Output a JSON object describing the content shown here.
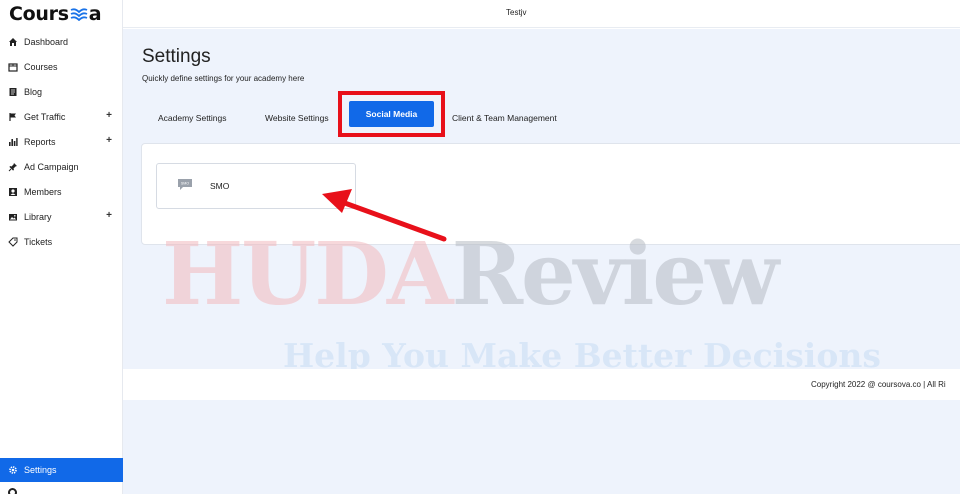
{
  "brand": {
    "name_prefix": "Cours",
    "name_suffix": "a",
    "book_icon": "open-book-icon"
  },
  "topbar": {
    "user": "Testjv"
  },
  "sidebar": {
    "items": [
      {
        "label": "Dashboard",
        "icon": "home-icon",
        "expandable": false
      },
      {
        "label": "Courses",
        "icon": "box-icon",
        "expandable": false
      },
      {
        "label": "Blog",
        "icon": "blog-icon",
        "expandable": false
      },
      {
        "label": "Get Traffic",
        "icon": "flag-icon",
        "expandable": true
      },
      {
        "label": "Reports",
        "icon": "bar-chart-icon",
        "expandable": true
      },
      {
        "label": "Ad Campaign",
        "icon": "pin-icon",
        "expandable": false
      },
      {
        "label": "Members",
        "icon": "person-icon",
        "expandable": false
      },
      {
        "label": "Library",
        "icon": "image-icon",
        "expandable": true
      },
      {
        "label": "Tickets",
        "icon": "ticket-icon",
        "expandable": false
      }
    ],
    "expand_symbol": "+",
    "active": {
      "label": "Settings",
      "icon": "gear-icon"
    }
  },
  "page": {
    "title": "Settings",
    "subtitle": "Quickly define settings for your academy here"
  },
  "tabs": {
    "items": [
      "Academy Settings",
      "Website Settings",
      "Social Media",
      "Client & Team Management"
    ],
    "active_index": 2
  },
  "card": {
    "smo_label": "SMO",
    "smo_icon_text": "SMO"
  },
  "watermark": {
    "main_a": "HUDA",
    "main_b": "Review",
    "sub": "Help You Make Better Decisions"
  },
  "footer": {
    "copyright": "Copyright 2022 @ coursova.co | All Ri"
  },
  "colors": {
    "accent": "#1169e8",
    "highlight": "#e8101a",
    "main_bg": "#eef3fc"
  }
}
